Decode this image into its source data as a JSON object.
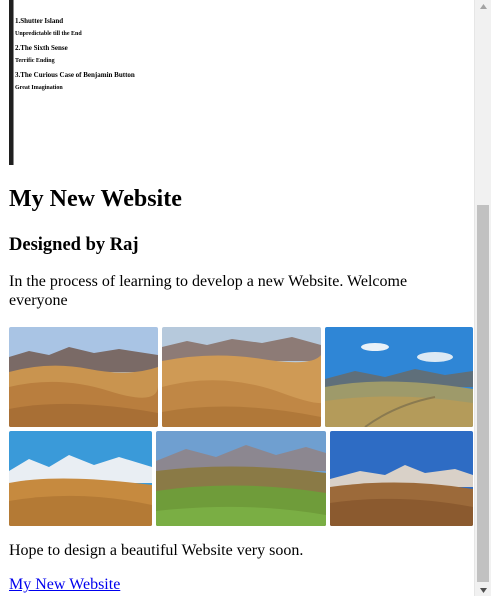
{
  "movies": [
    {
      "title": "1.Shutter Island",
      "desc": "Unpredictable till the End"
    },
    {
      "title": "2.The Sixth Sense",
      "desc": "Terrific Ending"
    },
    {
      "title": "3.The Curious Case of Benjamin Button",
      "desc": "Great Imagination"
    }
  ],
  "header": {
    "title": "My New Website",
    "subtitle": "Designed by Raj"
  },
  "intro": "In the process of learning to develop a new Website. Welcome everyone",
  "gallery": [
    {
      "name": "golden-hills-photo-1",
      "sky": "#a9c4e4",
      "mountain": "#7a6a66",
      "land": "#c9944f"
    },
    {
      "name": "golden-hills-photo-2",
      "sky": "#b6c9dc",
      "mountain": "#8d7b76",
      "land": "#cf9a55"
    },
    {
      "name": "mountain-valley-photo-3",
      "sky": "#2f86d6",
      "mountain": "#5f6f7a",
      "land": "#b49b5a"
    },
    {
      "name": "snowy-peaks-photo-4",
      "sky": "#3a9ad9",
      "mountain": "#e9eef3",
      "land": "#c68a3f"
    },
    {
      "name": "green-valley-photo-5",
      "sky": "#6f9fd0",
      "mountain": "#8c8790",
      "land": "#6f9c3a"
    },
    {
      "name": "sunset-hills-photo-6",
      "sky": "#2e6cc4",
      "mountain": "#d9d1c8",
      "land": "#8b5a2f"
    }
  ],
  "closing": "Hope to design a beautiful Website very soon.",
  "link": {
    "label": "My New Website"
  }
}
